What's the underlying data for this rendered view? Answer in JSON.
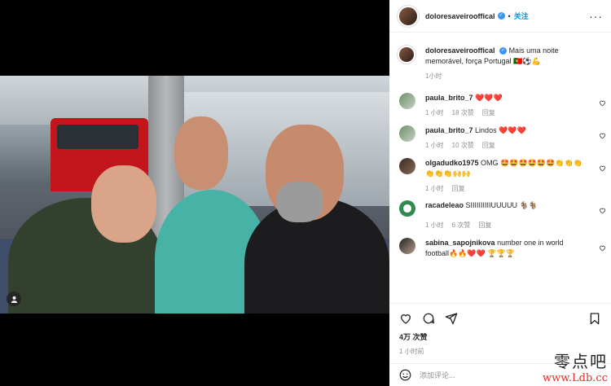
{
  "post": {
    "username": "doloresaveirooffical",
    "follow_label": "关注",
    "caption": "Mais uma noite memorável, força Portugal 🇵🇹⚽💪",
    "caption_time": "1小时",
    "likes": "4万 次赞",
    "time": "1 小时前"
  },
  "comments": [
    {
      "user": "paula_brito_7",
      "text": "❤️❤️❤️",
      "time": "1 小时",
      "likes": "18 次赞",
      "reply": "回复"
    },
    {
      "user": "paula_brito_7",
      "text": "Lindos ❤️❤️❤️",
      "time": "1 小时",
      "likes": "10 次赞",
      "reply": "回复"
    },
    {
      "user": "olgadudko1975",
      "text": "OMG 🤩🤩🤩🤩🤩🤩👏👏👏👏👏👏🙌🙌",
      "time": "1 小时",
      "likes": "",
      "reply": "回复"
    },
    {
      "user": "racadeleao",
      "text": "SIIIIIIIIIIUUUUU 🐐🐐",
      "time": "1 小时",
      "likes": "6 次赞",
      "reply": "回复"
    },
    {
      "user": "sabina_sapojnikova",
      "text": "number one in world football🔥🔥❤️❤️ 🏆🏆🏆",
      "time": "",
      "likes": "",
      "reply": ""
    }
  ],
  "add_comment_placeholder": "添加评论...",
  "watermark": {
    "line1": "零点吧",
    "line2": "www.Ldb.cc"
  },
  "icons": [
    "heart-icon",
    "comment-icon",
    "share-icon",
    "bookmark-icon",
    "emoji-icon",
    "more-icon",
    "user-tag-icon",
    "verified-icon"
  ],
  "colors": {
    "accent": "#0095f6",
    "verified": "#3897f0",
    "meta": "#8e8e8e",
    "heart": "#ed4956"
  }
}
